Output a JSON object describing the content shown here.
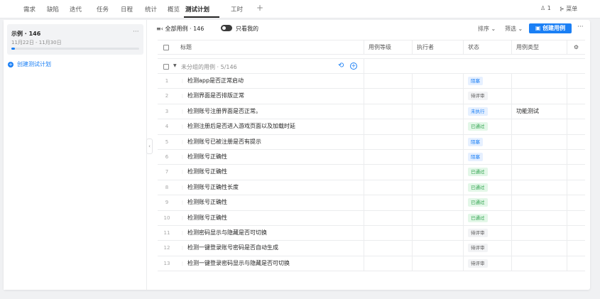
{
  "topnav": {
    "tabs": [
      "需求",
      "缺陷",
      "迭代",
      "任务",
      "日程",
      "统计",
      "概览",
      "测试计划",
      "工时"
    ],
    "active_tab": "测试计划",
    "member_count": "1",
    "menu_label": "菜单"
  },
  "sidebar": {
    "plan": {
      "name": "示例 · 146",
      "date_range": "11月22日 - 11月30日",
      "progress": 0.03
    },
    "create_plan_label": "创建测试计划"
  },
  "toolbar": {
    "all_cases_label": "全部用例 · 146",
    "only_mine_label": "只看我的",
    "sort_label": "排序",
    "filter_label": "筛选",
    "create_case_label": "创建用例"
  },
  "table": {
    "columns": [
      "标题",
      "用例等级",
      "执行者",
      "状态",
      "用例类型"
    ],
    "group_title": "未分组的用例 · 5/146",
    "rows": [
      {
        "index": "1",
        "title": "检测app是否正常启动",
        "status": "阻塞",
        "status_kind": "block",
        "type": ""
      },
      {
        "index": "2",
        "title": "检测界面是否排版正常",
        "status": "待评审",
        "status_kind": "review",
        "type": ""
      },
      {
        "index": "3",
        "title": "检测账号注册界面是否正常。",
        "status": "未执行",
        "status_kind": "notrun",
        "type": "功能测试"
      },
      {
        "index": "4",
        "title": "检测注册后是否进入游戏页面以及加载时延",
        "status": "已通过",
        "status_kind": "pass",
        "type": ""
      },
      {
        "index": "5",
        "title": "检测账号已被注册是否有提示",
        "status": "阻塞",
        "status_kind": "block",
        "type": ""
      },
      {
        "index": "6",
        "title": "检测账号正确性",
        "status": "阻塞",
        "status_kind": "block",
        "type": ""
      },
      {
        "index": "7",
        "title": "检测账号正确性",
        "status": "已通过",
        "status_kind": "pass",
        "type": ""
      },
      {
        "index": "8",
        "title": "检测账号正确性长度",
        "status": "已通过",
        "status_kind": "pass",
        "type": ""
      },
      {
        "index": "9",
        "title": "检测账号正确性",
        "status": "已通过",
        "status_kind": "pass",
        "type": ""
      },
      {
        "index": "10",
        "title": "检测账号正确性",
        "status": "已通过",
        "status_kind": "pass",
        "type": ""
      },
      {
        "index": "11",
        "title": "检测密码显示与隐藏是否可切换",
        "status": "待评审",
        "status_kind": "review",
        "type": ""
      },
      {
        "index": "12",
        "title": "检测一键登录账号密码是否自动生成",
        "status": "待评审",
        "status_kind": "review",
        "type": ""
      },
      {
        "index": "13",
        "title": "检测一键登录密码显示与隐藏是否可切换",
        "status": "待评审",
        "status_kind": "review",
        "type": ""
      }
    ]
  },
  "colors": {
    "accent": "#1a7ff5",
    "pass": "#2ba14a"
  },
  "icons": [
    "list-icon",
    "toggle-icon",
    "sort-chevron-icon",
    "filter-chevron-icon",
    "create-case-icon",
    "more-icon",
    "settings-icon",
    "plus-icon",
    "member-icon",
    "menu-icon",
    "collapse-icon",
    "circle-plus-icon",
    "sync-icon",
    "add-circle-icon"
  ]
}
